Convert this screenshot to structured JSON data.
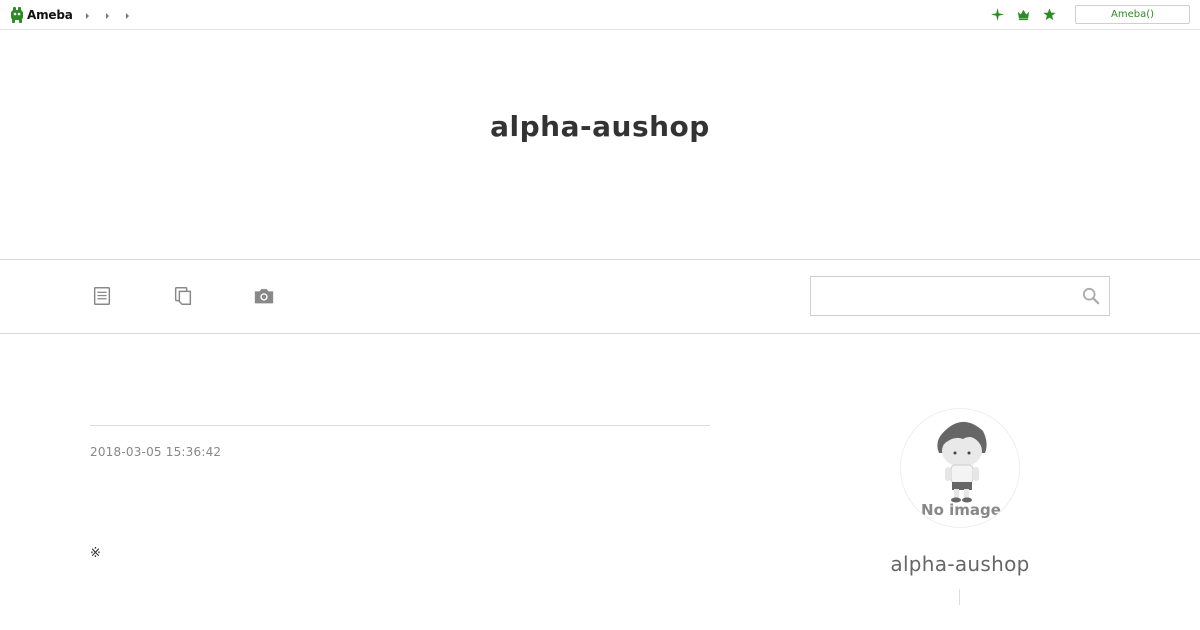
{
  "topbar": {
    "logo_text": "Ameba",
    "breadcrumbs": [
      "",
      "",
      ""
    ],
    "icons": [
      "sparkle-icon",
      "crown-icon",
      "star-icon"
    ],
    "ameba_button_label": "Ameba()",
    "accent_color": "#2d8a24"
  },
  "header": {
    "blog_title": "alpha-aushop"
  },
  "nav": {
    "items": [
      {
        "name": "entry-list-icon"
      },
      {
        "name": "theme-list-icon"
      },
      {
        "name": "photo-icon"
      }
    ],
    "search": {
      "placeholder": "",
      "value": ""
    }
  },
  "entry": {
    "date": "2018-03-05 15:36:42",
    "mark": "※"
  },
  "profile": {
    "avatar_text": "No image",
    "name": "alpha-aushop"
  }
}
